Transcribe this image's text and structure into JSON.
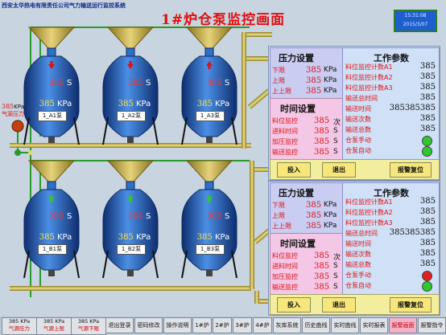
{
  "window": {
    "title": "西安太华热电有限责任公司气力输送运行监控系统"
  },
  "page_title": "1#炉仓泵监控画面",
  "clock": {
    "time": "15:31:08",
    "date": "2015/3/07"
  },
  "gas_pressure": {
    "value": "385",
    "unit": "KPa",
    "label": "气源压力"
  },
  "tanks": [
    {
      "name": "1_A1泵",
      "value": "385",
      "unit": "KPa",
      "s_value": "385",
      "s_unit": "S"
    },
    {
      "name": "1_A2泵",
      "value": "385",
      "unit": "KPa",
      "s_value": "385",
      "s_unit": "S"
    },
    {
      "name": "1_A3泵",
      "value": "385",
      "unit": "KPa",
      "s_value": "385",
      "s_unit": "S"
    },
    {
      "name": "1_B1泵",
      "value": "385",
      "unit": "KPa",
      "s_value": "385",
      "s_unit": "S"
    },
    {
      "name": "1_B2泵",
      "value": "385",
      "unit": "KPa",
      "s_value": "385",
      "s_unit": "S"
    },
    {
      "name": "1_B3泵",
      "value": "385",
      "unit": "KPa",
      "s_value": "385",
      "s_unit": "S"
    }
  ],
  "panels": [
    {
      "pressure_title": "压力设置",
      "pressure_rows": [
        {
          "label": "下限",
          "value": "385",
          "unit": "KPa"
        },
        {
          "label": "上限",
          "value": "385",
          "unit": "KPa"
        },
        {
          "label": "上上限",
          "value": "385",
          "unit": "KPa"
        }
      ],
      "time_title": "时间设置",
      "time_rows": [
        {
          "label": "料位监控",
          "value": "385",
          "unit": "次"
        },
        {
          "label": "进料时间",
          "value": "385",
          "unit": "S"
        },
        {
          "label": "加压监控",
          "value": "385",
          "unit": "S"
        },
        {
          "label": "输送监控",
          "value": "385",
          "unit": "S"
        }
      ],
      "work_title": "工作参数",
      "work_rows": [
        {
          "label": "料位监控计数A1",
          "value": "385"
        },
        {
          "label": "料位监控计数A2",
          "value": "385"
        },
        {
          "label": "料位监控计数A3",
          "value": "385"
        },
        {
          "label": "输送总时间",
          "value": "385"
        },
        {
          "label": "输送时间",
          "value": "385385385"
        },
        {
          "label": "输送次数",
          "value": "385"
        },
        {
          "label": "输送总数",
          "value": "385"
        },
        {
          "label": "仓泵手动",
          "value": ""
        },
        {
          "label": "仓泵自动",
          "value": ""
        }
      ],
      "leds": [
        "#2fc62f",
        "#2fc62f"
      ],
      "buttons": {
        "start": "投入",
        "exit": "退出",
        "reset": "报警复位"
      }
    },
    {
      "pressure_title": "压力设置",
      "pressure_rows": [
        {
          "label": "下限",
          "value": "385",
          "unit": "KPa"
        },
        {
          "label": "上限",
          "value": "385",
          "unit": "KPa"
        },
        {
          "label": "上上限",
          "value": "385",
          "unit": "KPa"
        }
      ],
      "time_title": "时间设置",
      "time_rows": [
        {
          "label": "料位监控",
          "value": "385",
          "unit": "次"
        },
        {
          "label": "进料时间",
          "value": "385",
          "unit": "S"
        },
        {
          "label": "加压监控",
          "value": "385",
          "unit": "S"
        },
        {
          "label": "输送监控",
          "value": "385",
          "unit": "S"
        }
      ],
      "work_title": "工作参数",
      "work_rows": [
        {
          "label": "料位监控计数A1",
          "value": "385"
        },
        {
          "label": "料位监控计数A2",
          "value": "385"
        },
        {
          "label": "料位监控计数A3",
          "value": "385"
        },
        {
          "label": "输送总时间",
          "value": "385385385"
        },
        {
          "label": "输送时间",
          "value": "385"
        },
        {
          "label": "输送次数",
          "value": "385"
        },
        {
          "label": "输送总数",
          "value": "385"
        },
        {
          "label": "仓泵手动",
          "value": ""
        },
        {
          "label": "仓泵自动",
          "value": ""
        }
      ],
      "leds": [
        "#e02020",
        "#2fc62f"
      ],
      "buttons": {
        "start": "投入",
        "exit": "退出",
        "reset": "报警复位"
      }
    }
  ],
  "nav": {
    "gauges": [
      {
        "value": "385 KPa",
        "label": "气源压力"
      },
      {
        "value": "385 KPa",
        "label": "气源上限"
      },
      {
        "value": "385 KPa",
        "label": "气源下限"
      }
    ],
    "buttons": [
      "退出登录",
      "密码修改",
      "操作说明",
      "1#炉",
      "2#炉",
      "3#炉",
      "4#炉",
      "灰库系统",
      "历史曲线",
      "实时曲线",
      "实时报表",
      "报警画面",
      "报警指令"
    ]
  },
  "colors": {
    "pipe": "#c9b23a",
    "tank": "#2f6fc8",
    "hopper": "#c2a84b",
    "alarm": "#e01010"
  }
}
